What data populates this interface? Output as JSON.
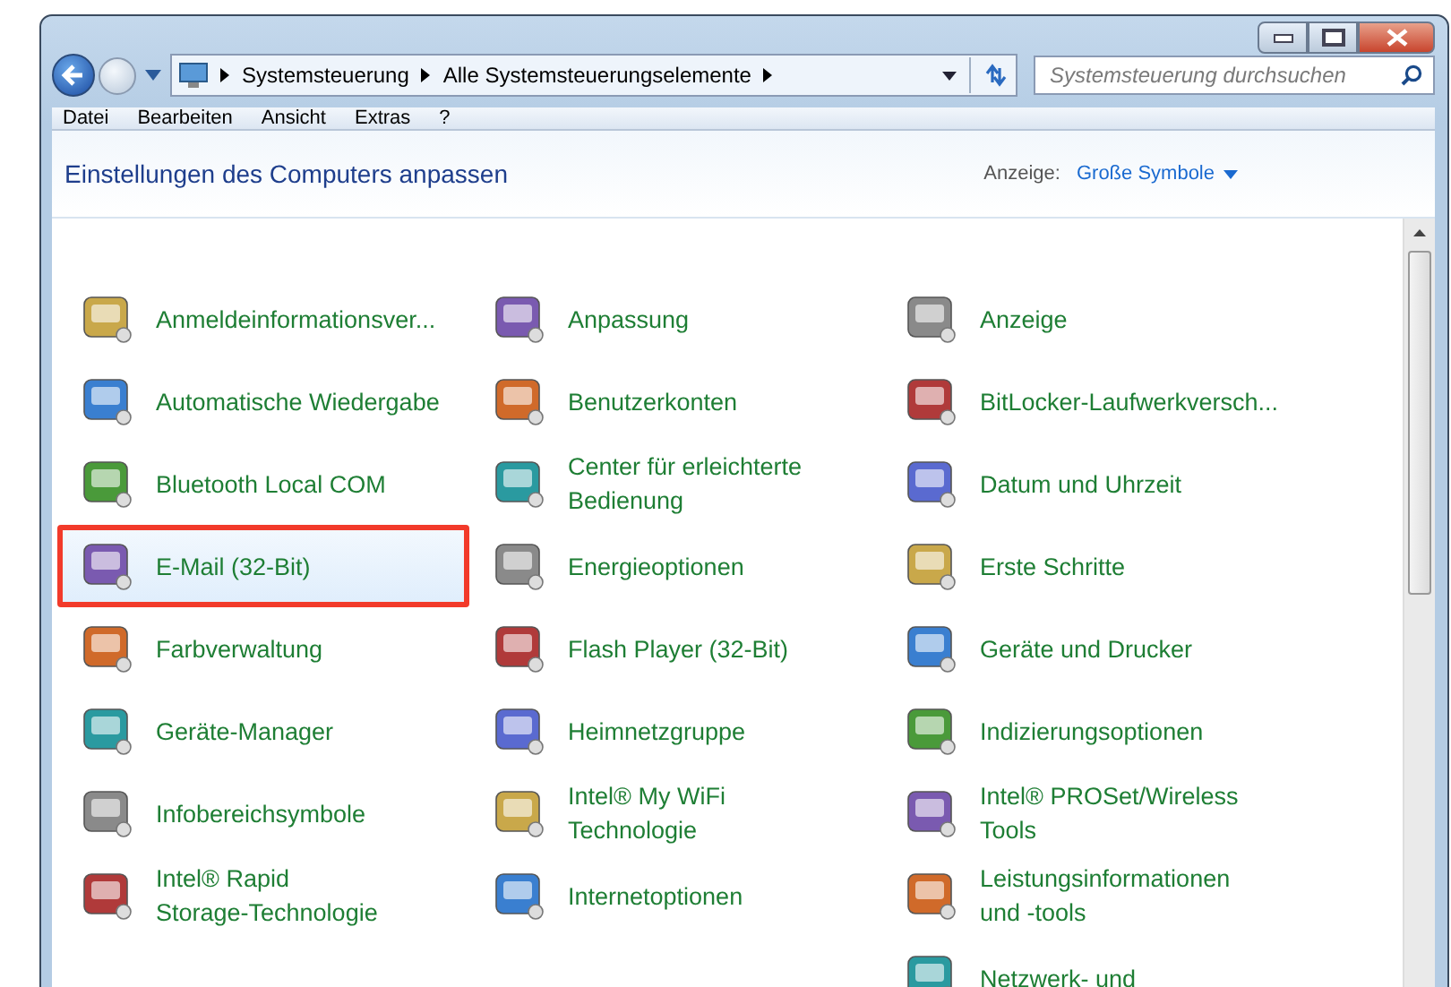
{
  "address_bar": {
    "path": [
      "Systemsteuerung",
      "Alle Systemsteuerungselemente"
    ]
  },
  "search": {
    "placeholder": "Systemsteuerung durchsuchen"
  },
  "menu": [
    "Datei",
    "Bearbeiten",
    "Ansicht",
    "Extras",
    "?"
  ],
  "header": {
    "title": "Einstellungen des Computers anpassen",
    "view_label": "Anzeige:",
    "view_value": "Große Symbole"
  },
  "columns": [
    [
      {
        "label": "Anmeldeinformationsver...",
        "selected": false
      },
      {
        "label": "Automatische Wiedergabe",
        "selected": false
      },
      {
        "label": "Bluetooth Local COM",
        "selected": false
      },
      {
        "label": "E-Mail (32-Bit)",
        "selected": true
      },
      {
        "label": "Farbverwaltung",
        "selected": false
      },
      {
        "label": "Geräte-Manager",
        "selected": false
      },
      {
        "label": "Infobereichsymbole",
        "selected": false
      },
      {
        "label": "Intel® Rapid\nStorage-Technologie",
        "selected": false
      }
    ],
    [
      {
        "label": "Anpassung",
        "selected": false
      },
      {
        "label": "Benutzerkonten",
        "selected": false
      },
      {
        "label": "Center für erleichterte\nBedienung",
        "selected": false
      },
      {
        "label": "Energieoptionen",
        "selected": false
      },
      {
        "label": "Flash Player (32-Bit)",
        "selected": false
      },
      {
        "label": "Heimnetzgruppe",
        "selected": false
      },
      {
        "label": "Intel® My WiFi\nTechnologie",
        "selected": false
      },
      {
        "label": "Internetoptionen",
        "selected": false
      }
    ],
    [
      {
        "label": "Anzeige",
        "selected": false
      },
      {
        "label": "BitLocker-Laufwerkversch...",
        "selected": false
      },
      {
        "label": "Datum und Uhrzeit",
        "selected": false
      },
      {
        "label": "Erste Schritte",
        "selected": false
      },
      {
        "label": "Geräte und Drucker",
        "selected": false
      },
      {
        "label": "Indizierungsoptionen",
        "selected": false
      },
      {
        "label": "Intel® PROSet/Wireless\nTools",
        "selected": false
      },
      {
        "label": "Leistungsinformationen\nund -tools",
        "selected": false
      },
      {
        "label": "Netzwerk- und",
        "selected": false
      }
    ]
  ]
}
